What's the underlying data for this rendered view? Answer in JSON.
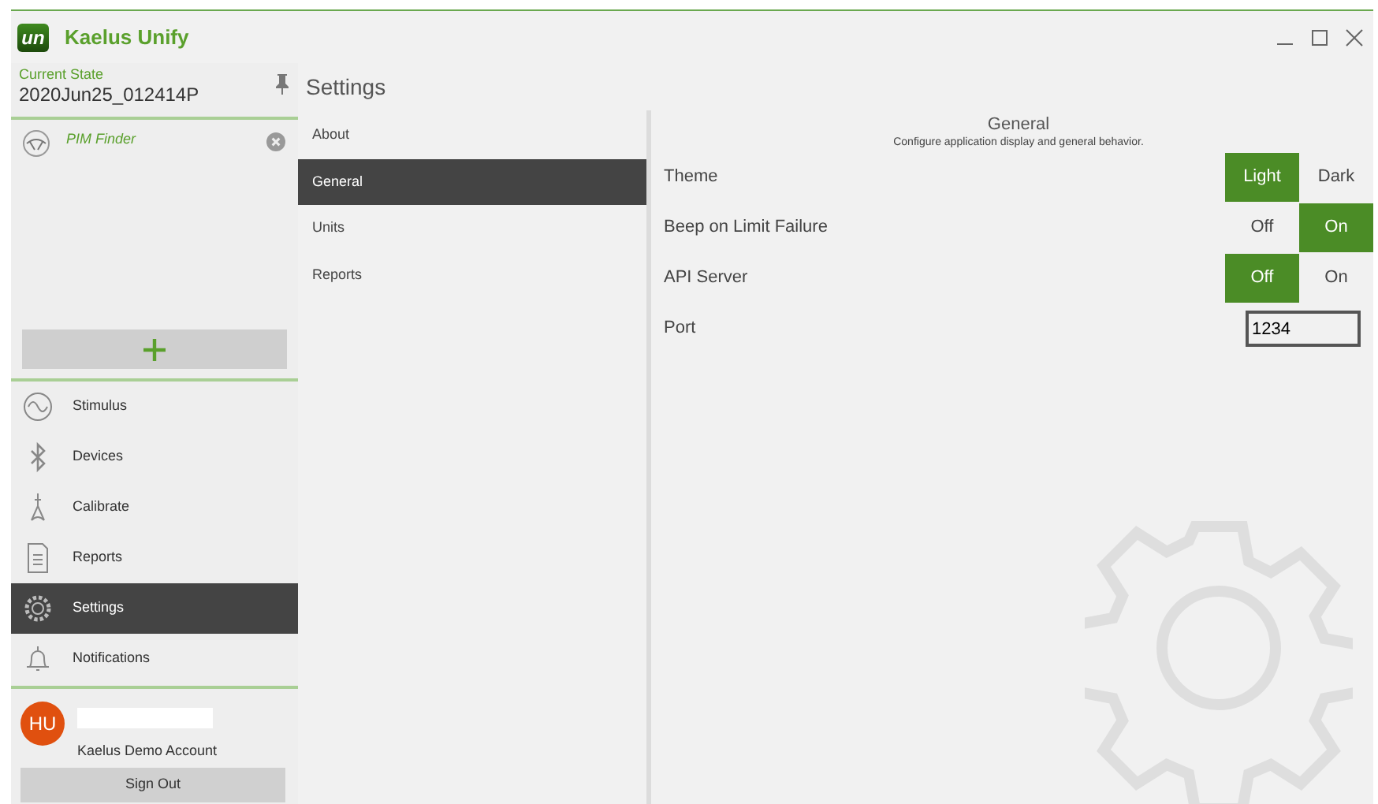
{
  "window": {
    "title": "Kaelus Unify",
    "logo": "un"
  },
  "sidebar": {
    "current_state": {
      "label": "Current State",
      "value": "2020Jun25_012414P"
    },
    "workspaces": [
      {
        "label": "PIM Finder"
      }
    ],
    "nav": [
      {
        "label": "Stimulus",
        "selected": false
      },
      {
        "label": "Devices",
        "selected": false
      },
      {
        "label": "Calibrate",
        "selected": false
      },
      {
        "label": "Reports",
        "selected": false
      },
      {
        "label": "Settings",
        "selected": true
      },
      {
        "label": "Notifications",
        "selected": false
      }
    ],
    "user": {
      "initials": "HU",
      "account": "Kaelus Demo Account"
    },
    "sign_out": "Sign Out"
  },
  "settings": {
    "title": "Settings",
    "sections": [
      {
        "label": "About",
        "selected": false
      },
      {
        "label": "General",
        "selected": true
      },
      {
        "label": "Units",
        "selected": false
      },
      {
        "label": "Reports",
        "selected": false
      }
    ],
    "panel": {
      "title": "General",
      "description": "Configure application display and general behavior.",
      "options": [
        {
          "kind": "toggle",
          "label": "Theme",
          "choices": [
            {
              "label": "Light",
              "selected": true
            },
            {
              "label": "Dark",
              "selected": false
            }
          ]
        },
        {
          "kind": "toggle",
          "label": "Beep on Limit Failure",
          "choices": [
            {
              "label": "Off",
              "selected": false
            },
            {
              "label": "On",
              "selected": true
            }
          ]
        },
        {
          "kind": "toggle",
          "label": "API Server",
          "choices": [
            {
              "label": "Off",
              "selected": true
            },
            {
              "label": "On",
              "selected": false
            }
          ]
        },
        {
          "kind": "input",
          "label": "Port",
          "value": "1234"
        }
      ]
    }
  }
}
